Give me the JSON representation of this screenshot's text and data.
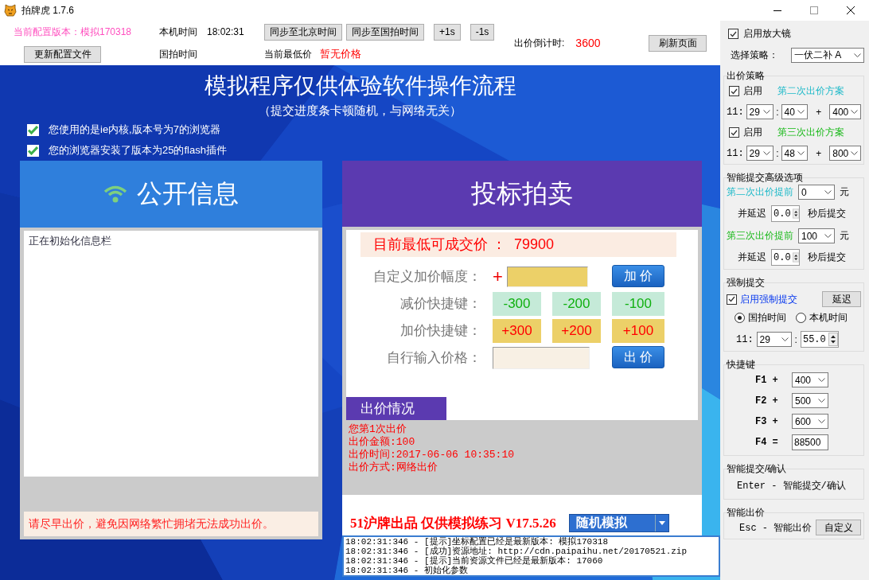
{
  "window": {
    "title": "拍牌虎 1.7.6"
  },
  "header": {
    "config_version": "当前配置版本：模拟170318",
    "update_button": "更新配置文件",
    "local_time_label": "本机时间",
    "local_time": "18:02:31",
    "sync_beijing_button": "同步至北京时间",
    "sync_guopai_button": "同步至国拍时间",
    "plus_button": "+1s",
    "minus_button": "-1s",
    "guopai_time_label": "国拍时间",
    "lowest_price_label": "当前最低价",
    "lowest_price": "暂无价格",
    "countdown_label": "出价倒计时:",
    "countdown": "3600",
    "refresh_button": "刷新页面"
  },
  "sim": {
    "title": "模拟程序仅供体验软件操作流程",
    "subtitle": "（提交进度条卡顿随机，与网络无关）",
    "checks": [
      {
        "label": "您使用的是ie内核,版本号为7的浏览器",
        "checked": true
      },
      {
        "label": "您的浏览器安装了版本为25的flash插件",
        "checked": true
      }
    ],
    "info_panel": {
      "title": "公开信息",
      "message": "正在初始化信息栏",
      "notice": "请尽早出价，避免因网络繁忙拥堵无法成功出价。"
    },
    "bid_panel": {
      "title": "投标拍卖",
      "price_label": "目前最低可成交价 ：",
      "price": "79900",
      "custom_label": "自定义加价幅度：",
      "plus_sign": "+",
      "add_button": "加 价",
      "minus_label": "减价快捷键：",
      "minus_keys": [
        "-300",
        "-200",
        "-100"
      ],
      "plus_label": "加价快捷键：",
      "plus_keys": [
        "+300",
        "+200",
        "+100"
      ],
      "input_label": "自行输入价格：",
      "bid_button": "出 价",
      "status_tab": "出价情况",
      "status_lines": [
        "您第1次出价",
        "出价金额:100",
        "出价时间:2017-06-06 10:35:10",
        "出价方式:网络出价"
      ],
      "footer": "51沪牌出品 仅供模拟练习 V17.5.26",
      "mode": "随机模拟"
    },
    "log": [
      "18:02:31:346 - [提示]坐标配置已经是最新版本: 模拟170318",
      "18:02:31:346 - [成功]资源地址: http://cdn.paipaihu.net/20170521.zip",
      "18:02:31:346 - [提示]当前资源文件已经是最新版本: 17060",
      "18:02:31:346 - 初始化参数"
    ]
  },
  "side": {
    "magnifier": {
      "label": "启用放大镜",
      "checked": true
    },
    "strategy": {
      "label": "选择策略：",
      "value": "一伏二补 A"
    },
    "bid_strategy": {
      "title": "出价策略",
      "plans": [
        {
          "enable_label": "启用",
          "checked": true,
          "name": "第二次出价方案",
          "kind": "second",
          "hour": "11:",
          "minute": "29",
          "sep": ":",
          "second": "40",
          "plus": "+",
          "add": "400"
        },
        {
          "enable_label": "启用",
          "checked": true,
          "name": "第三次出价方案",
          "kind": "third",
          "hour": "11:",
          "minute": "29",
          "sep": ":",
          "second": "48",
          "plus": "+",
          "add": "800"
        }
      ]
    },
    "advanced": {
      "title": "智能提交高级选项",
      "rows": [
        {
          "label": "第二次出价提前",
          "kind": "second",
          "amount": "0",
          "unit": "元",
          "delay_label": "并延迟",
          "delay": "0.0",
          "after": "秒后提交"
        },
        {
          "label": "第三次出价提前",
          "kind": "third",
          "amount": "100",
          "unit": "元",
          "delay_label": "并延迟",
          "delay": "0.0",
          "after": "秒后提交"
        }
      ]
    },
    "force": {
      "title": "强制提交",
      "enable_label": "启用强制提交",
      "checked": true,
      "delay_button": "延迟",
      "clocks": [
        {
          "label": "国拍时间",
          "selected": true
        },
        {
          "label": "本机时间",
          "selected": false
        }
      ],
      "hour": "11:",
      "minute": "29",
      "sep": ":",
      "second": "55.0"
    },
    "hotkeys": {
      "title": "快捷键",
      "keys": [
        {
          "label": "F1 +",
          "value": "400",
          "kind": "select"
        },
        {
          "label": "F2 +",
          "value": "500",
          "kind": "select"
        },
        {
          "label": "F3 +",
          "value": "600",
          "kind": "select"
        },
        {
          "label": "F4 =",
          "value": "88500",
          "kind": "input"
        }
      ]
    },
    "smart_submit": {
      "title": "智能提交/确认",
      "text": "Enter - 智能提交/确认"
    },
    "smart_bid": {
      "title": "智能出价",
      "text": "Esc - 智能出价",
      "button": "自定义"
    }
  }
}
